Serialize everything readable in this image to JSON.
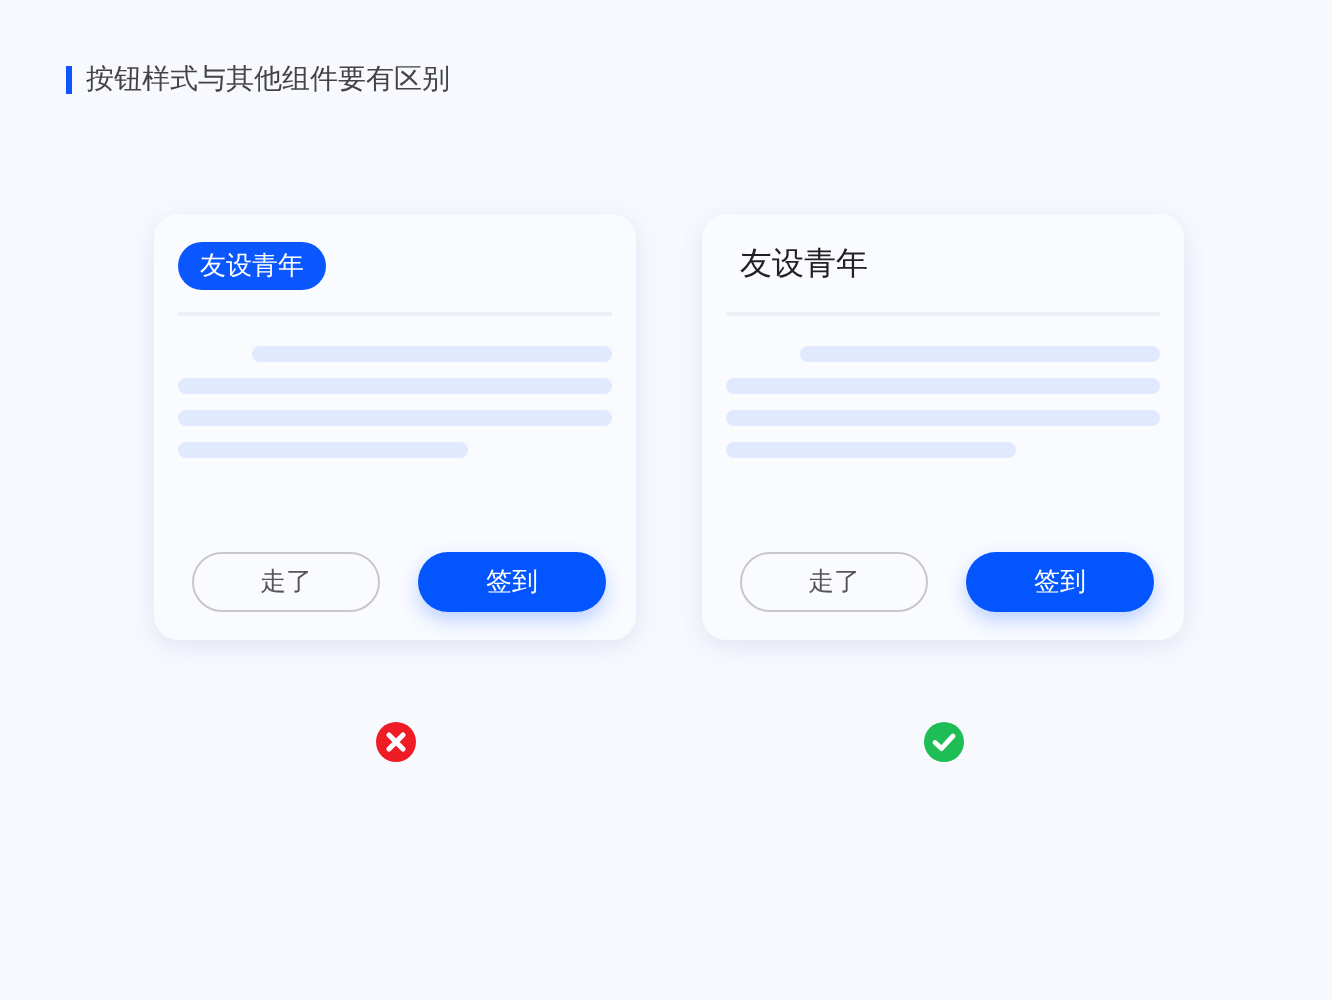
{
  "heading": "按钮样式与其他组件要有区别",
  "examples": [
    {
      "title": {
        "text": "友设青年",
        "kind": "tag"
      },
      "buttons": [
        {
          "label": "走了",
          "kind": "secondary"
        },
        {
          "label": "签到",
          "kind": "primary"
        }
      ],
      "verdict": {
        "kind": "wrong"
      }
    },
    {
      "title": {
        "text": "友设青年",
        "kind": "plain"
      },
      "buttons": [
        {
          "label": "走了",
          "kind": "secondary"
        },
        {
          "label": "签到",
          "kind": "primary"
        }
      ],
      "verdict": {
        "kind": "right"
      }
    }
  ]
}
